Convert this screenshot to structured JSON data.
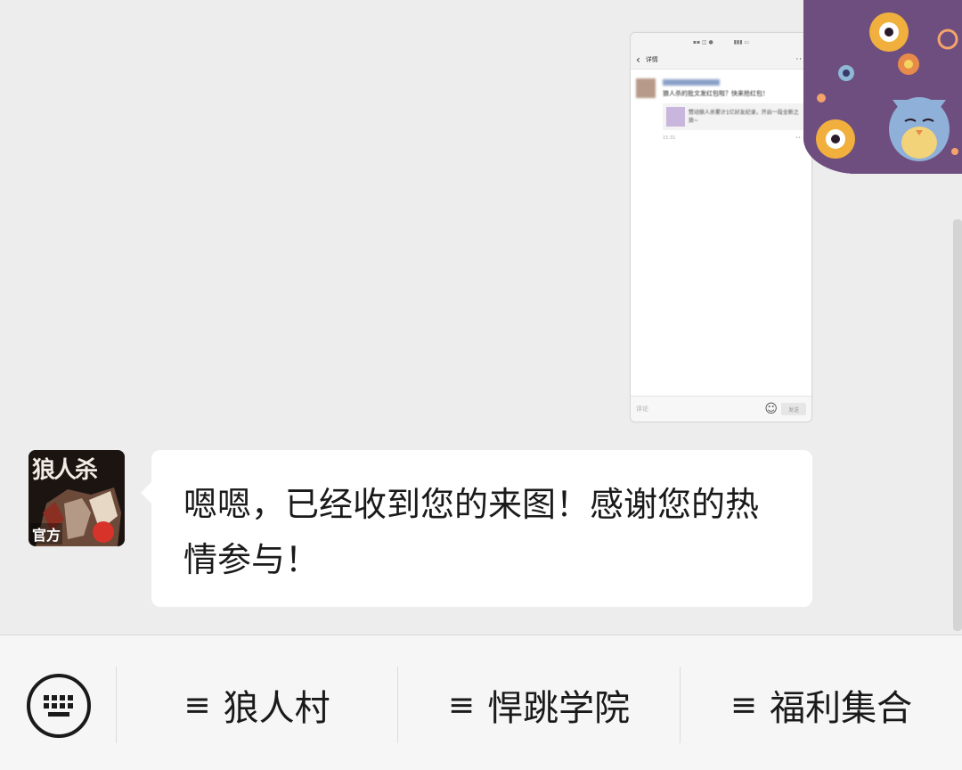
{
  "sent_image": {
    "nav_title": "详情",
    "post_text": "狼人杀的批文发红包啦？快来抢红包！",
    "card_text": "赞动狼人杀累计1亿好友纪录，开启一段全新之旅~",
    "time": "15:31",
    "input_placeholder": "评论",
    "send_label": "发送"
  },
  "message": {
    "avatar_text": "狼人杀",
    "avatar_badge": "官方",
    "text": "嗯嗯，已经收到您的来图！感谢您的热情参与！"
  },
  "menu": {
    "items": [
      {
        "glyph": "≡",
        "label": "狼人村"
      },
      {
        "glyph": "≡",
        "label": "悍跳学院"
      },
      {
        "glyph": "≡",
        "label": "福利集合"
      }
    ]
  },
  "colors": {
    "chat_bg": "#ededed",
    "bubble_bg": "#ffffff",
    "menu_bg": "#f6f6f6",
    "avatar_purple": "#6e4e7e"
  }
}
